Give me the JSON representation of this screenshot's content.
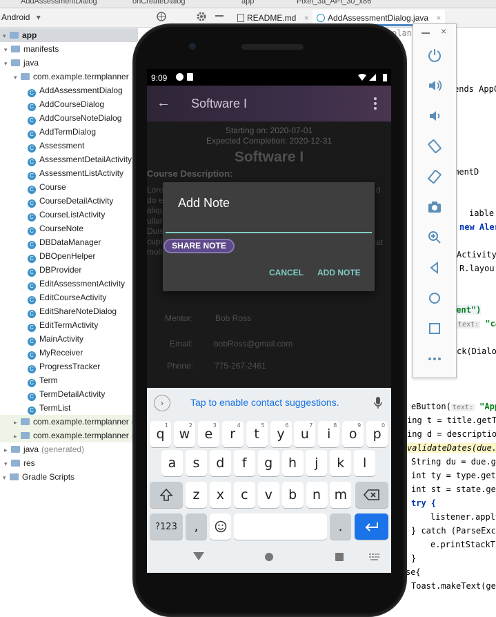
{
  "ide": {
    "top_tabs": [
      "AddAssessmentDialog",
      "onCreateDialog",
      "app",
      "Pixel_3a_API_30_x86"
    ],
    "android_selector": "Android",
    "editor_tabs": [
      "README.md",
      "AddAssessmentDialog.java"
    ],
    "tree": [
      {
        "label": "app",
        "type": "folder",
        "level": 0
      },
      {
        "label": "manifests",
        "type": "folder",
        "level": 1
      },
      {
        "label": "java",
        "type": "folder",
        "level": 1
      },
      {
        "label": "com.example.termplanner",
        "type": "folder",
        "level": 2
      },
      {
        "label": "AddAssessmentDialog",
        "type": "class",
        "level": 3
      },
      {
        "label": "AddCourseDialog",
        "type": "class",
        "level": 3
      },
      {
        "label": "AddCourseNoteDialog",
        "type": "class",
        "level": 3
      },
      {
        "label": "AddTermDialog",
        "type": "class",
        "level": 3
      },
      {
        "label": "Assessment",
        "type": "class",
        "level": 3
      },
      {
        "label": "AssessmentDetailActivity",
        "type": "class",
        "level": 3
      },
      {
        "label": "AssessmentListActivity",
        "type": "class",
        "level": 3
      },
      {
        "label": "Course",
        "type": "class",
        "level": 3
      },
      {
        "label": "CourseDetailActivity",
        "type": "class",
        "level": 3
      },
      {
        "label": "CourseListActivity",
        "type": "class",
        "level": 3
      },
      {
        "label": "CourseNote",
        "type": "class",
        "level": 3
      },
      {
        "label": "DBDataManager",
        "type": "class",
        "level": 3
      },
      {
        "label": "DBOpenHelper",
        "type": "class",
        "level": 3
      },
      {
        "label": "DBProvider",
        "type": "class",
        "level": 3
      },
      {
        "label": "EditAssessmentActivity",
        "type": "class",
        "level": 3
      },
      {
        "label": "EditCourseActivity",
        "type": "class",
        "level": 3
      },
      {
        "label": "EditShareNoteDialog",
        "type": "class",
        "level": 3
      },
      {
        "label": "EditTermActivity",
        "type": "class",
        "level": 3
      },
      {
        "label": "MainActivity",
        "type": "class",
        "level": 3
      },
      {
        "label": "MyReceiver",
        "type": "class",
        "level": 3
      },
      {
        "label": "ProgressTracker",
        "type": "class",
        "level": 3
      },
      {
        "label": "Term",
        "type": "class",
        "level": 3
      },
      {
        "label": "TermDetailActivity",
        "type": "class",
        "level": 3
      },
      {
        "label": "TermList",
        "type": "class",
        "level": 3
      },
      {
        "label": "com.example.termplanner",
        "type": "folder",
        "level": 2,
        "suffix": "(an"
      },
      {
        "label": "com.example.termplanner",
        "type": "folder",
        "level": 2,
        "suffix": "(tes"
      },
      {
        "label": "java",
        "type": "folder",
        "level": 1,
        "suffix": "(generated)"
      },
      {
        "label": "res",
        "type": "folder",
        "level": 1
      },
      {
        "label": "Gradle Scripts",
        "type": "folder",
        "level": 0
      }
    ],
    "code": {
      "l1": "plann",
      "l2": "ends AppCo",
      "l3": "ssessmentD",
      "l4a": "iable Bu",
      "l4b": "new Aler",
      "l5": "Activity(",
      "l6": "R.layou",
      "l7": "ment\")",
      "l8hint": "text:",
      "l8": "\"cance",
      "l9": "ck(Dialog",
      "l10a": "eButton(",
      "l10hint": "text:",
      "l10b": "\"Apply",
      "l11": "ing t = title.getTe",
      "l12": "ing d = descriptio",
      "l13": "validateDates(due.g",
      "l14": "String du = due.ge",
      "l15": "int ty = type.getS",
      "l16": "int st = state.get",
      "l17": "try {",
      "l18": "listener.apply",
      "l19": "} catch (ParseExce",
      "l20": "e.printStackTr",
      "l21": "}",
      "l22": "se{",
      "l23": "Toast.makeText(get"
    }
  },
  "phone": {
    "status": {
      "time": "9:09"
    },
    "appbar": {
      "title": "Software I"
    },
    "course": {
      "starting": "Starting on: 2020-07-01",
      "expected": "Expected Completion: 2020-12-31",
      "title": "Software I",
      "desc_label": "Course Description:",
      "desc_lines": [
        "Lore",
        "do e",
        "aliqu",
        "ullan",
        "Duis",
        "cupi",
        "moll"
      ],
      "desc_right": [
        "d",
        "cat"
      ],
      "mentor_label": "Mentor:",
      "mentor_value": "Bob Ross",
      "email_label": "Email:",
      "email_value": "bobRoss@gmail.com",
      "phone_label": "Phone:",
      "phone_value": "775-267-2461"
    },
    "dialog": {
      "title": "Add Note",
      "input_value": "",
      "share_button": "SHARE NOTE",
      "cancel_button": "CANCEL",
      "add_button": "ADD NOTE"
    },
    "keyboard": {
      "suggestion": "Tap to enable contact suggestions.",
      "row1": [
        [
          "q",
          "1"
        ],
        [
          "w",
          "2"
        ],
        [
          "e",
          "3"
        ],
        [
          "r",
          "4"
        ],
        [
          "t",
          "5"
        ],
        [
          "y",
          "6"
        ],
        [
          "u",
          "7"
        ],
        [
          "i",
          "8"
        ],
        [
          "o",
          "9"
        ],
        [
          "p",
          "0"
        ]
      ],
      "row2": [
        "a",
        "s",
        "d",
        "f",
        "g",
        "h",
        "j",
        "k",
        "l"
      ],
      "row3": [
        "z",
        "x",
        "c",
        "v",
        "b",
        "n",
        "m"
      ],
      "symbols_key": "?123",
      "comma_key": ",",
      "period_key": "."
    }
  },
  "colors": {
    "accent_teal": "#80cbc4",
    "chip_purple": "#5e4a8a",
    "enter_blue": "#1a73e8"
  }
}
